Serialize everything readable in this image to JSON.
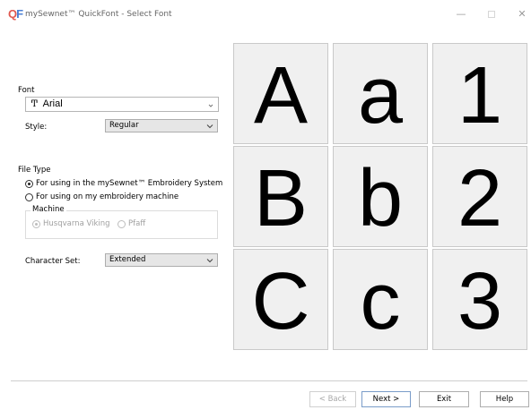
{
  "window": {
    "icon_text": "QF",
    "title": "mySewnet™ QuickFont - Select Font",
    "minimize_glyph": "—",
    "close_glyph": "✕"
  },
  "font_section": {
    "label": "Font",
    "font_value": "Arial",
    "font_type_icon": "Ͳ",
    "style_label": "Style:",
    "style_value": "Regular"
  },
  "file_type": {
    "label": "File Type",
    "options": [
      {
        "label": "For using in the mySewnet™ Embroidery System",
        "selected": true
      },
      {
        "label": "For using on my embroidery machine",
        "selected": false
      }
    ],
    "machine_label": "Machine",
    "machines": [
      {
        "label": "Husqvarna Viking",
        "selected": true,
        "enabled": false
      },
      {
        "label": "Pfaff",
        "selected": false,
        "enabled": false
      }
    ]
  },
  "character_set": {
    "label": "Character Set:",
    "value": "Extended"
  },
  "preview": {
    "glyphs": [
      "A",
      "a",
      "1",
      "B",
      "b",
      "2",
      "C",
      "c",
      "3"
    ]
  },
  "buttons": {
    "back": "< Back",
    "next": "Next >",
    "exit": "Exit",
    "help": "Help"
  }
}
